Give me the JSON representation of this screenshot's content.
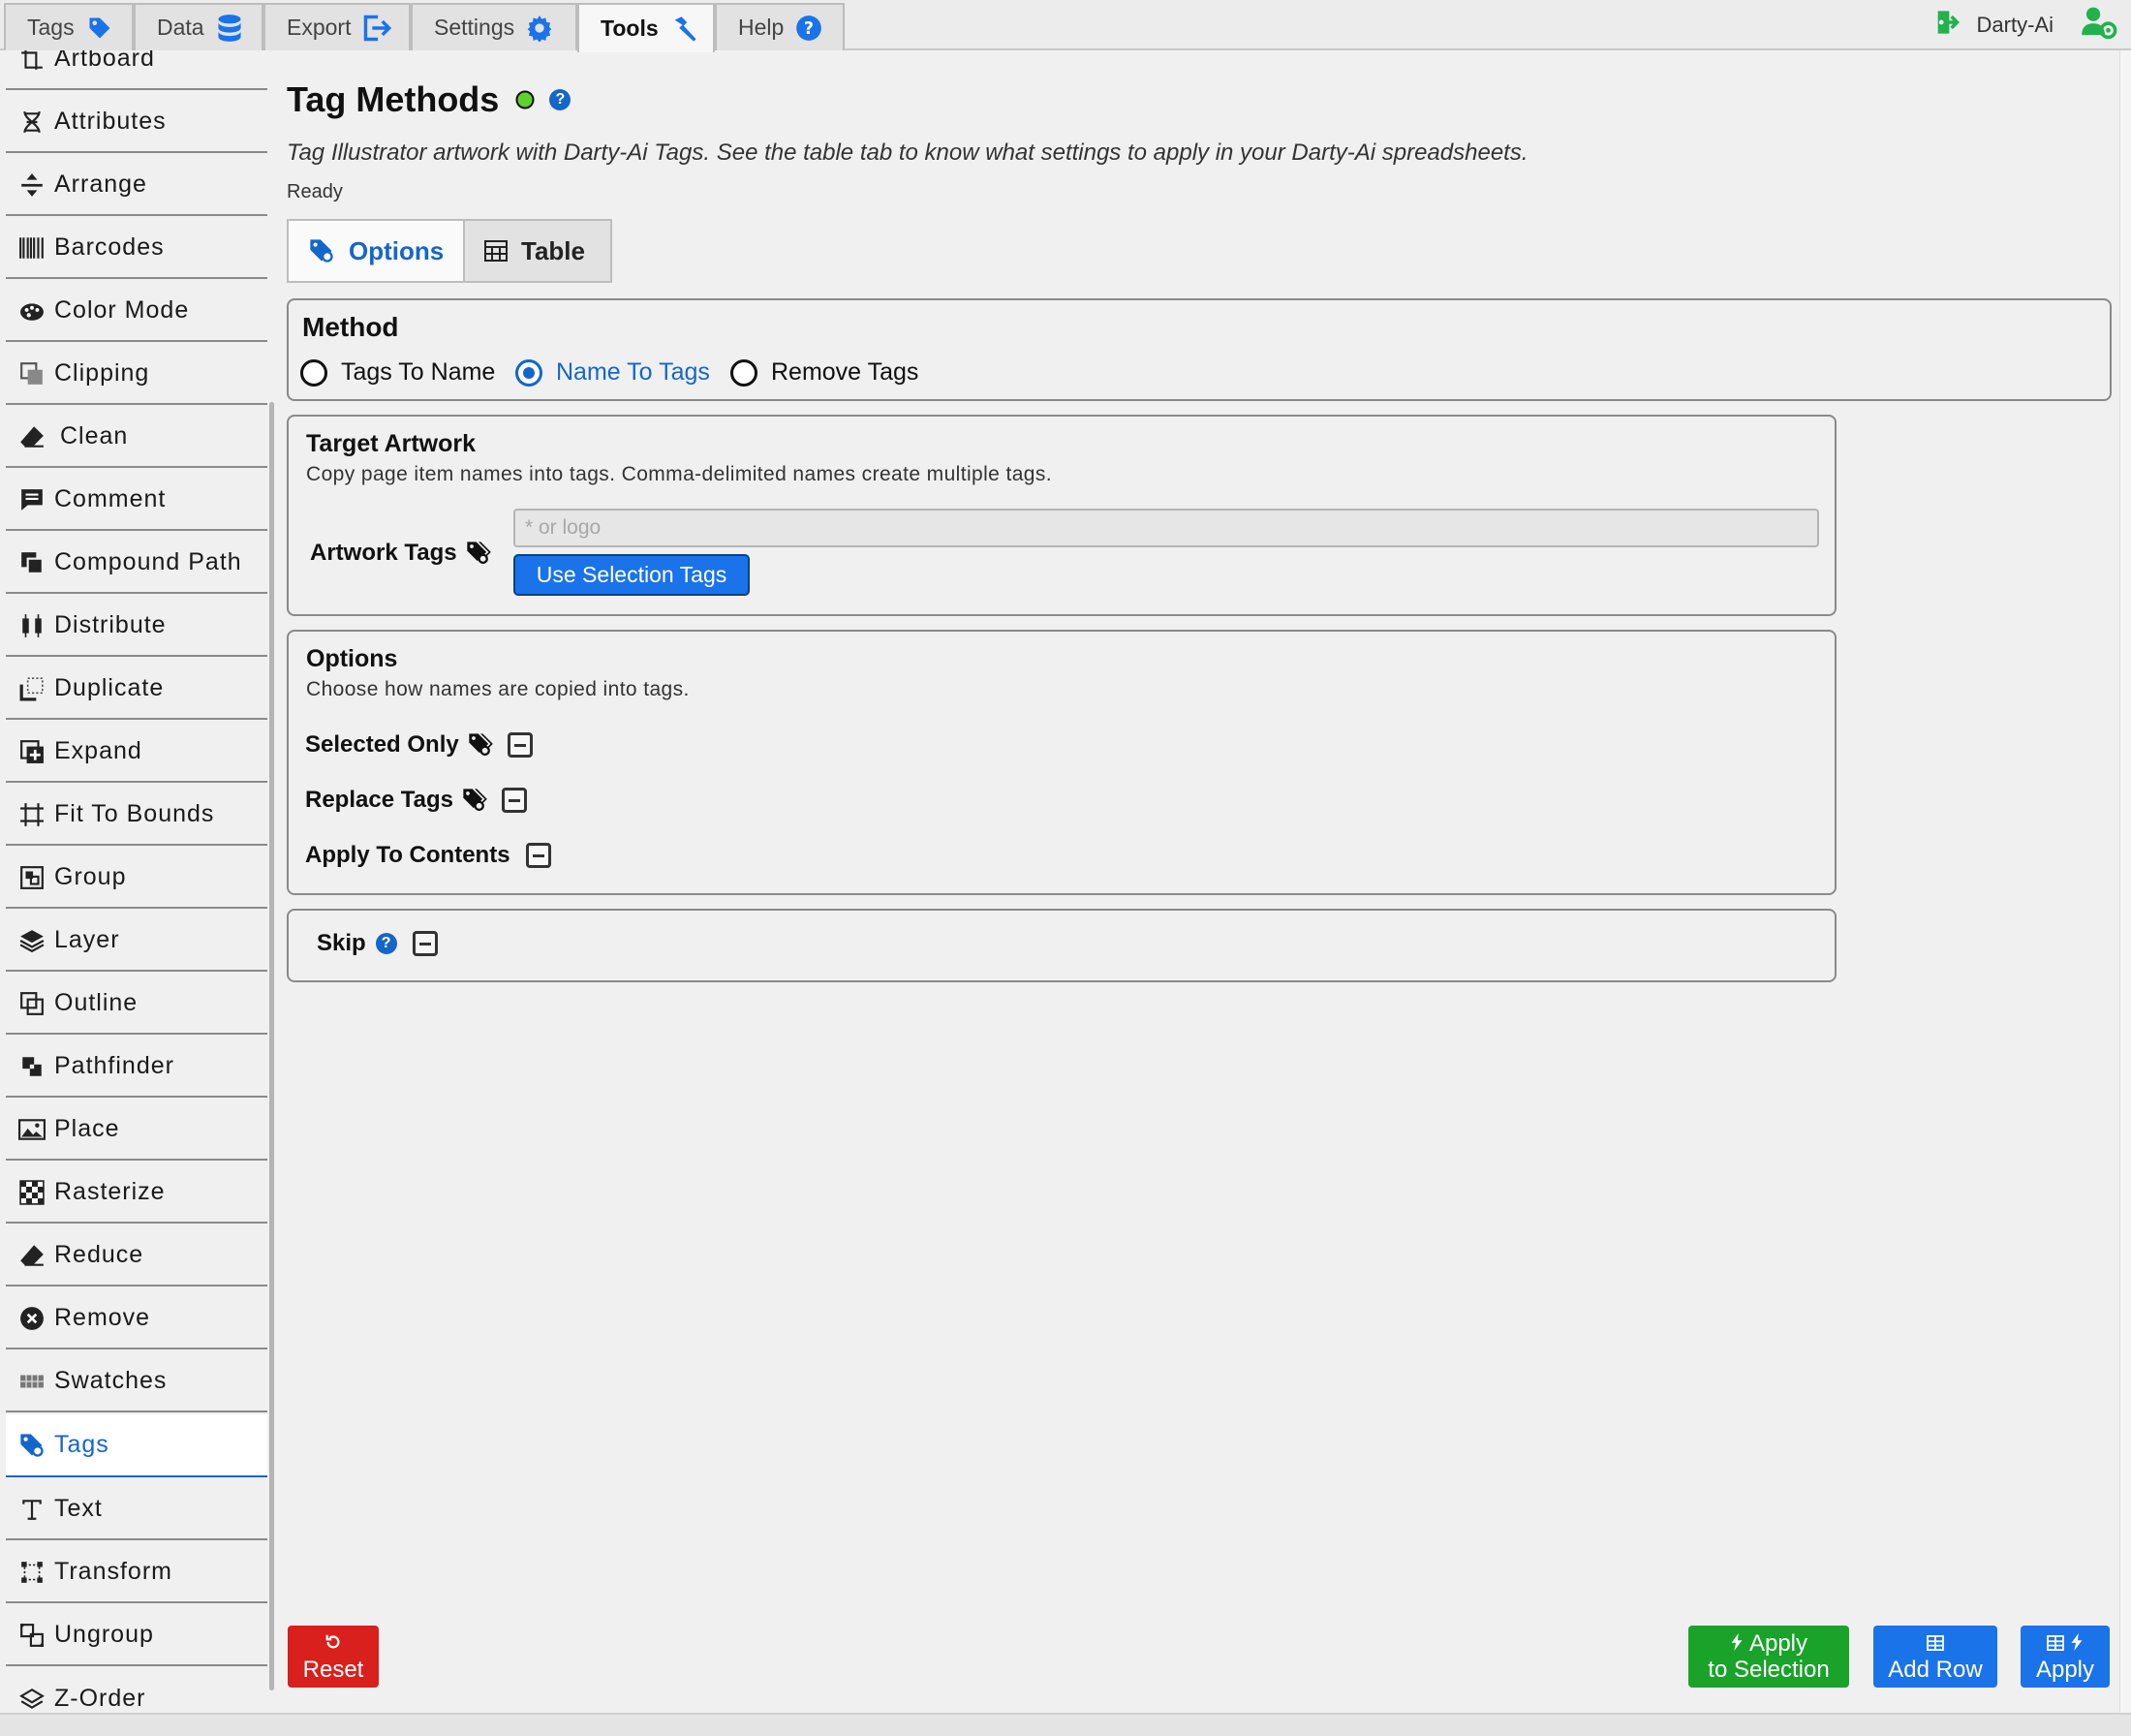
{
  "top_tabs": [
    {
      "label": "Tags",
      "icon": "tag-icon"
    },
    {
      "label": "Data",
      "icon": "database-icon"
    },
    {
      "label": "Export",
      "icon": "export-icon"
    },
    {
      "label": "Settings",
      "icon": "gear-icon"
    },
    {
      "label": "Tools",
      "icon": "hammer-icon",
      "active": true
    },
    {
      "label": "Help",
      "icon": "help-icon"
    }
  ],
  "user": {
    "name": "Darty-Ai"
  },
  "sidebar": {
    "items": [
      {
        "label": "Artboard",
        "icon": "artboard-icon"
      },
      {
        "label": "Attributes",
        "icon": "dna-icon"
      },
      {
        "label": "Arrange",
        "icon": "arrange-icon"
      },
      {
        "label": "Barcodes",
        "icon": "barcode-icon"
      },
      {
        "label": "Color Mode",
        "icon": "palette-icon"
      },
      {
        "label": "Clipping",
        "icon": "clipping-icon"
      },
      {
        "label": "Clean",
        "icon": "eraser-icon"
      },
      {
        "label": "Comment",
        "icon": "comment-icon"
      },
      {
        "label": "Compound Path",
        "icon": "compound-path-icon"
      },
      {
        "label": "Distribute",
        "icon": "distribute-icon"
      },
      {
        "label": "Duplicate",
        "icon": "duplicate-icon"
      },
      {
        "label": "Expand",
        "icon": "expand-icon"
      },
      {
        "label": "Fit To Bounds",
        "icon": "crop-icon"
      },
      {
        "label": "Group",
        "icon": "group-icon"
      },
      {
        "label": "Layer",
        "icon": "layers-icon"
      },
      {
        "label": "Outline",
        "icon": "outline-icon"
      },
      {
        "label": "Pathfinder",
        "icon": "pathfinder-icon"
      },
      {
        "label": "Place",
        "icon": "image-icon"
      },
      {
        "label": "Rasterize",
        "icon": "checker-icon"
      },
      {
        "label": "Reduce",
        "icon": "eraser-icon"
      },
      {
        "label": "Remove",
        "icon": "remove-circle-icon"
      },
      {
        "label": "Swatches",
        "icon": "swatches-icon"
      },
      {
        "label": "Tags",
        "icon": "tag-icon",
        "active": true
      },
      {
        "label": "Text",
        "icon": "text-icon"
      },
      {
        "label": "Transform",
        "icon": "transform-icon"
      },
      {
        "label": "Ungroup",
        "icon": "ungroup-icon"
      },
      {
        "label": "Z-Order",
        "icon": "z-order-icon"
      }
    ]
  },
  "main": {
    "title": "Tag Methods",
    "subtitle": "Tag Illustrator artwork with Darty-Ai Tags. See the table tab to know what settings to apply in your Darty-Ai spreadsheets.",
    "status": "Ready",
    "subtabs": [
      {
        "label": "Options",
        "icon": "tag-icon",
        "active": true
      },
      {
        "label": "Table",
        "icon": "table-icon"
      }
    ],
    "method": {
      "title": "Method",
      "options": [
        "Tags To Name",
        "Name To Tags",
        "Remove Tags"
      ],
      "selected": "Name To Tags"
    },
    "target": {
      "title": "Target Artwork",
      "desc": "Copy page item names into tags. Comma-delimited names create multiple tags.",
      "artwork_tags_label": "Artwork Tags",
      "input_placeholder": "* or logo",
      "input_value": "",
      "use_selection_label": "Use Selection Tags"
    },
    "options": {
      "title": "Options",
      "desc": "Choose how names are copied into tags.",
      "selected_only": "Selected Only",
      "replace_tags": "Replace Tags",
      "apply_to_contents": "Apply To Contents"
    },
    "skip": {
      "label": "Skip"
    }
  },
  "footer": {
    "reset": "Reset",
    "apply_selection_l1": "Apply",
    "apply_selection_l2": "to Selection",
    "add_row": "Add Row",
    "apply": "Apply"
  },
  "colors": {
    "accent": "#1566c9",
    "primary_button": "#1a73e8",
    "reset_red": "#d9201c",
    "green": "#1aa32a",
    "status_ok": "#5fd12e",
    "user_green": "#22b14c"
  }
}
